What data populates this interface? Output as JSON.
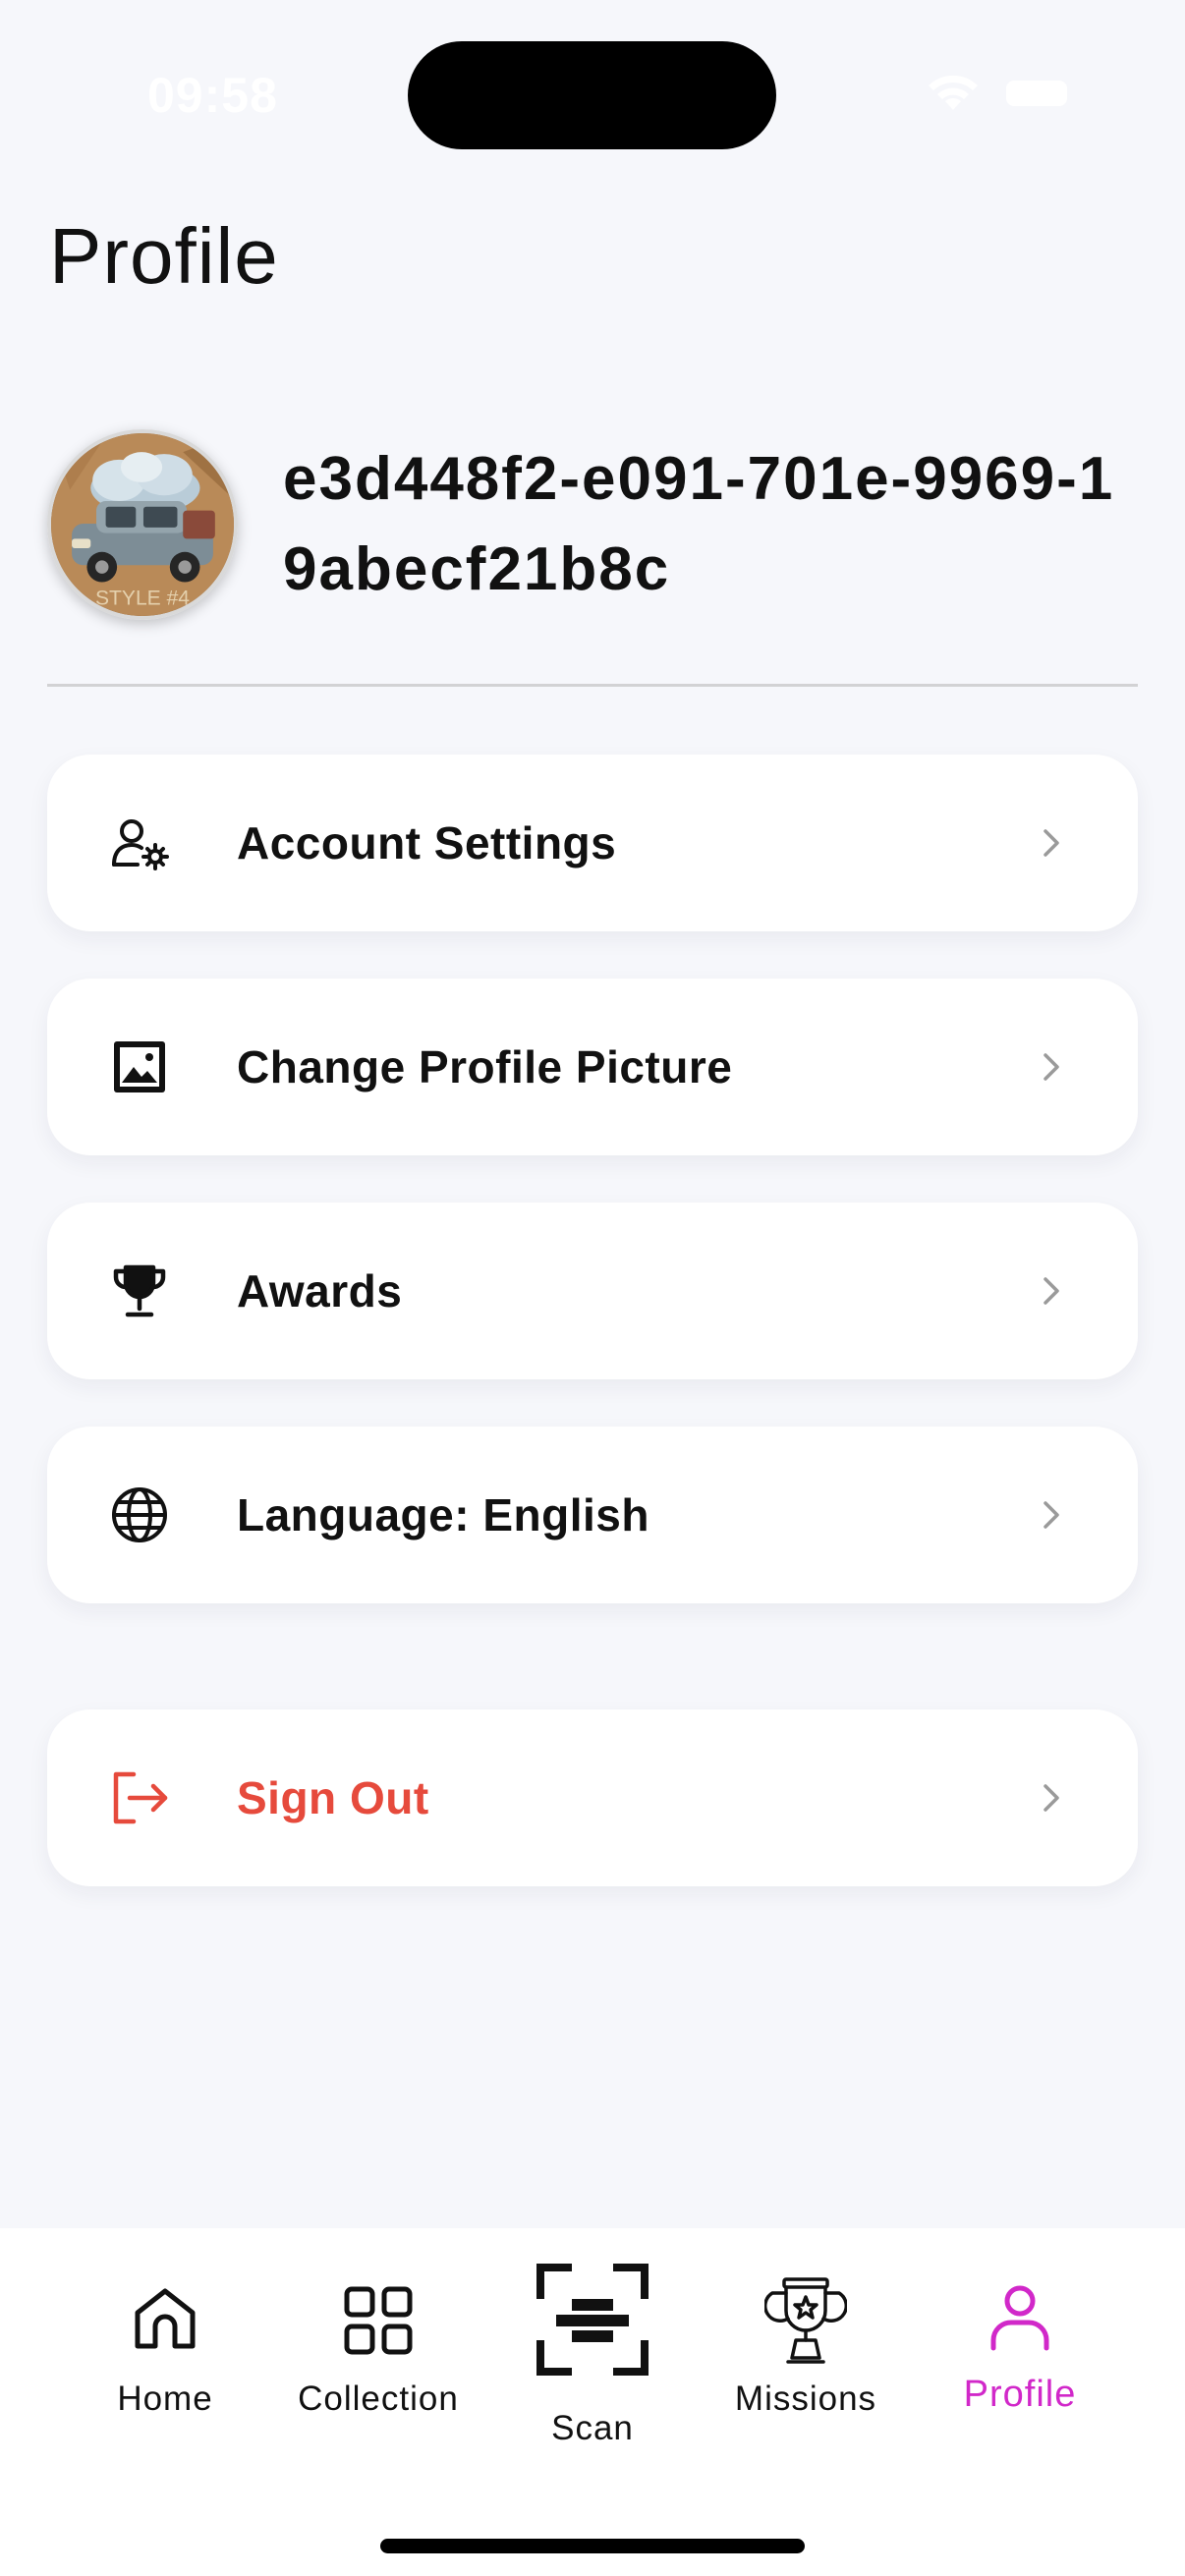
{
  "status_bar": {
    "time": "09:58"
  },
  "page": {
    "title": "Profile"
  },
  "profile": {
    "user_id": "e3d448f2-e091-701e-9969-19abecf21b8c",
    "avatar_caption": "STYLE #4"
  },
  "menu": {
    "account_settings": "Account Settings",
    "change_picture": "Change Profile Picture",
    "awards": "Awards",
    "language": "Language: English",
    "sign_out": "Sign Out"
  },
  "tabs": {
    "home": "Home",
    "collection": "Collection",
    "scan": "Scan",
    "missions": "Missions",
    "profile": "Profile"
  },
  "colors": {
    "accent": "#d128c9",
    "danger": "#e64a3c",
    "background": "#f6f7fb",
    "card": "#ffffff"
  },
  "icons": {
    "account_settings": "user-gear-icon",
    "change_picture": "image-icon",
    "awards": "trophy-icon",
    "language": "globe-icon",
    "sign_out": "logout-icon",
    "chevron": "chevron-right-icon"
  }
}
